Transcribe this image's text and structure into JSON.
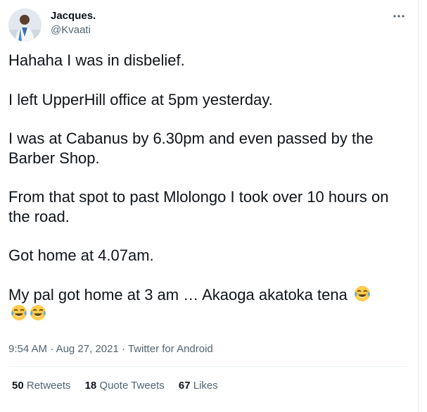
{
  "author": {
    "display_name": "Jacques.",
    "handle": "@Kvaati",
    "avatar": "avatar-photo"
  },
  "more_icon": "more-horizontal-icon",
  "tweet": {
    "paragraphs": [
      "Hahaha I was in disbelief.",
      "I left UpperHill office at 5pm yesterday.",
      "I was at Cabanus by 6.30pm and even passed by the Barber Shop.",
      "From that spot to past Mlolongo I took over 10 hours on the road.",
      "Got home at 4.07am.",
      "My pal got home at 3 am … Akaoga akatoka tena"
    ],
    "emojis": [
      "face-with-tears-of-joy",
      "face-with-tears-of-joy",
      "face-with-tears-of-joy"
    ]
  },
  "meta": {
    "time": "9:54 AM",
    "separator": "·",
    "date": "Aug 27, 2021",
    "source": "Twitter for Android"
  },
  "stats": {
    "retweets_count": "50",
    "retweets_label": "Retweets",
    "quotes_count": "18",
    "quotes_label": "Quote Tweets",
    "likes_count": "67",
    "likes_label": "Likes"
  }
}
